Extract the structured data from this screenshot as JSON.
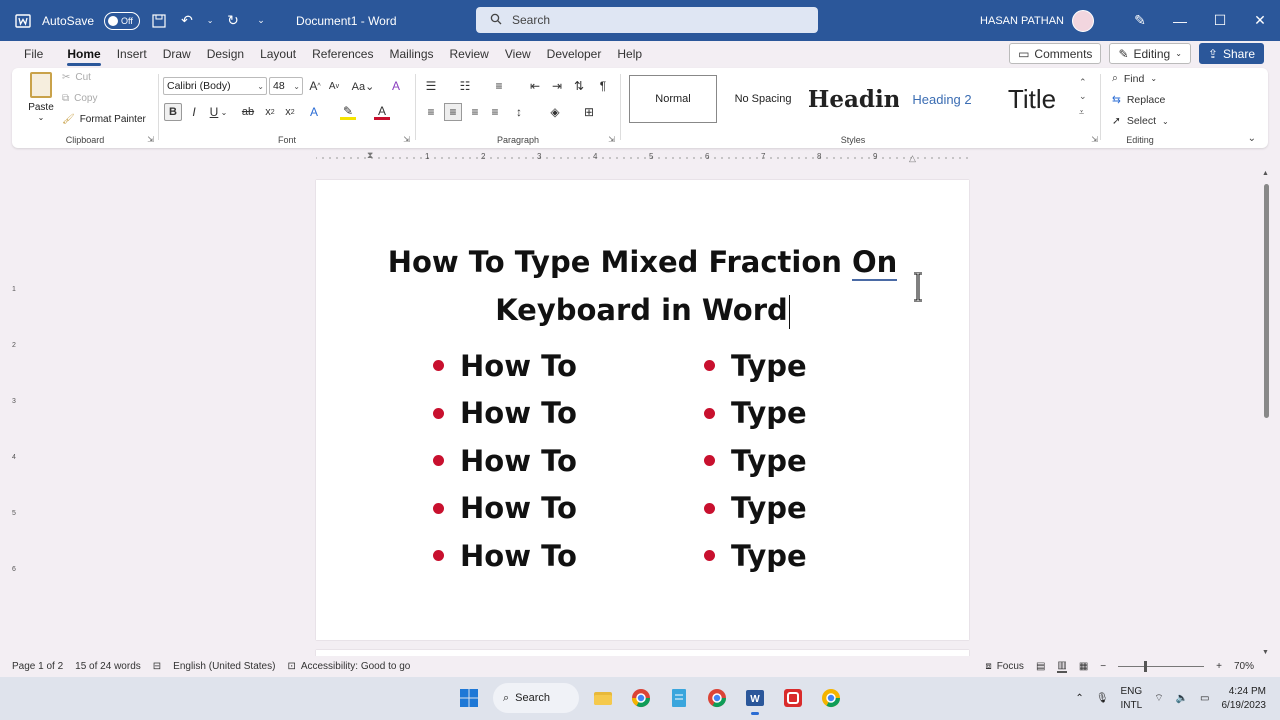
{
  "titlebar": {
    "autosave_label": "AutoSave",
    "autosave_state": "Off",
    "doc_title": "Document1  -  Word",
    "search_placeholder": "Search",
    "user_name": "HASAN PATHAN",
    "accent_color": "#2b579a"
  },
  "menu": {
    "tabs": [
      "File",
      "Home",
      "Insert",
      "Draw",
      "Design",
      "Layout",
      "References",
      "Mailings",
      "Review",
      "View",
      "Developer",
      "Help"
    ],
    "active_tab": "Home",
    "comments_label": "Comments",
    "editing_label": "Editing",
    "share_label": "Share"
  },
  "ribbon": {
    "clipboard": {
      "paste": "Paste",
      "cut": "Cut",
      "copy": "Copy",
      "format_painter": "Format Painter",
      "label": "Clipboard"
    },
    "font": {
      "name": "Calibri (Body)",
      "size": "48",
      "label": "Font"
    },
    "paragraph": {
      "label": "Paragraph"
    },
    "styles": {
      "items": [
        "Normal",
        "No Spacing",
        "Headin",
        "Heading 2",
        "Title"
      ],
      "label": "Styles"
    },
    "editing": {
      "find": "Find",
      "replace": "Replace",
      "select": "Select",
      "label": "Editing"
    }
  },
  "ruler": {
    "numbers": [
      "1",
      "2",
      "3",
      "4",
      "5",
      "6",
      "7",
      "8",
      "9"
    ]
  },
  "vruler": {
    "numbers": [
      "1",
      "2",
      "3",
      "4",
      "5",
      "6"
    ]
  },
  "document": {
    "heading_line1_main": "How To Type Mixed Fraction ",
    "heading_line1_underlined": "On",
    "heading_line2": "Keyboard in Word",
    "left_bullets": [
      "How To",
      "How To",
      "How To",
      "How To",
      "How To"
    ],
    "right_bullets": [
      "Type",
      "Type",
      "Type",
      "Type",
      "Type"
    ],
    "bullet_color": "#c8102e"
  },
  "status": {
    "page": "Page 1 of 2",
    "words": "15 of 24 words",
    "language": "English (United States)",
    "accessibility": "Accessibility: Good to go",
    "focus": "Focus",
    "zoom": "70%"
  },
  "taskbar": {
    "search_label": "Search",
    "lang_top": "ENG",
    "lang_bottom": "INTL",
    "time": "4:24 PM",
    "date": "6/19/2023"
  }
}
